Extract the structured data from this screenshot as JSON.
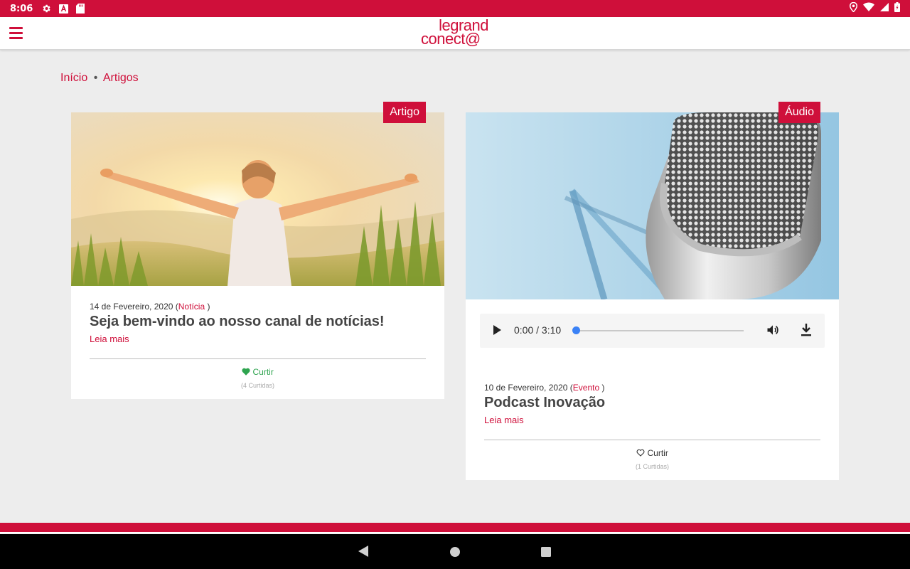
{
  "status_bar": {
    "time": "8:06"
  },
  "header": {
    "logo_line1": "legrand",
    "logo_line2": "conect@"
  },
  "breadcrumb": {
    "home": "Início",
    "separator": "•",
    "current": "Artigos"
  },
  "cards": [
    {
      "tag": "Artigo",
      "date": "14 de Fevereiro, 2020",
      "category": "Notícia",
      "title": "Seja bem-vindo ao nosso canal de notícias!",
      "read_more": "Leia mais",
      "like_label": "Curtir",
      "likes_count": "(4 Curtidas)",
      "liked": true
    },
    {
      "tag": "Áudio",
      "date": "10 de Fevereiro, 2020",
      "category": "Evento",
      "title": "Podcast Inovação",
      "read_more": "Leia mais",
      "like_label": "Curtir",
      "likes_count": "(1 Curtidas)",
      "liked": false,
      "audio": {
        "time_display": "0:00 / 3:10",
        "progress": 0
      }
    }
  ],
  "colors": {
    "brand": "#cf0f3a",
    "liked": "#2ea44f",
    "audio_thumb": "#3b82f6"
  }
}
